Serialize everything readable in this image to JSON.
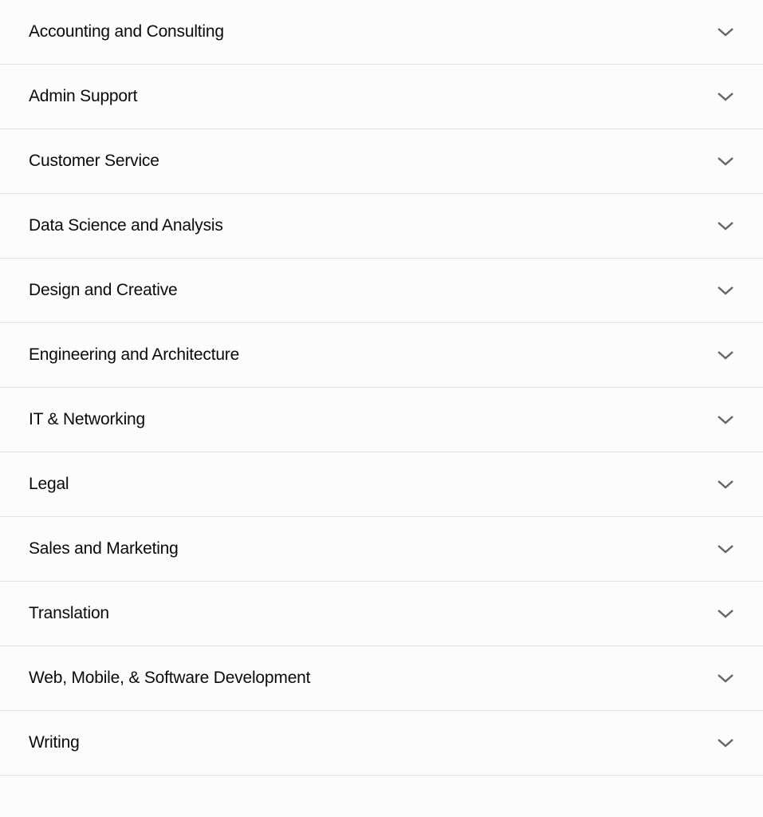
{
  "categories": [
    {
      "label": "Accounting and Consulting",
      "slug": "accounting-and-consulting"
    },
    {
      "label": "Admin Support",
      "slug": "admin-support"
    },
    {
      "label": "Customer Service",
      "slug": "customer-service"
    },
    {
      "label": "Data Science and Analysis",
      "slug": "data-science-and-analysis"
    },
    {
      "label": "Design and Creative",
      "slug": "design-and-creative"
    },
    {
      "label": "Engineering and Architecture",
      "slug": "engineering-and-architecture"
    },
    {
      "label": "IT & Networking",
      "slug": "it-and-networking"
    },
    {
      "label": "Legal",
      "slug": "legal"
    },
    {
      "label": "Sales and Marketing",
      "slug": "sales-and-marketing"
    },
    {
      "label": "Translation",
      "slug": "translation"
    },
    {
      "label": "Web, Mobile, & Software Development",
      "slug": "web-mobile-software-development"
    },
    {
      "label": "Writing",
      "slug": "writing"
    }
  ]
}
